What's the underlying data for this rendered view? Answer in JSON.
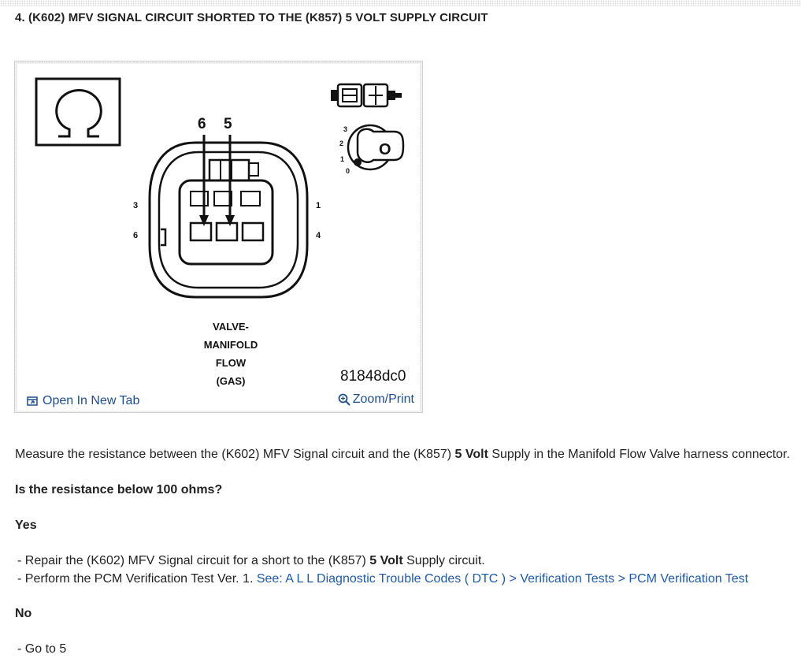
{
  "step": {
    "title": "4. (K602) MFV SIGNAL CIRCUIT SHORTED TO THE (K857) 5 VOLT SUPPLY CIRCUIT"
  },
  "figure": {
    "pin_labels": {
      "top_left": "6",
      "top_right": "5",
      "left_upper": "3",
      "left_lower": "6",
      "right_upper": "1",
      "right_lower": "4"
    },
    "key_positions": [
      "3",
      "2",
      "1",
      "0"
    ],
    "key_letter": "O",
    "component_label_lines": [
      "VALVE-",
      "MANIFOLD",
      "FLOW",
      "(GAS)"
    ],
    "code": "81848dc0",
    "open_new_tab_label": "Open In New Tab",
    "zoom_print_label": "Zoom/Print",
    "icons": {
      "omega": "ohmmeter-icon",
      "connector": "connector-icon",
      "key": "ignition-key-icon",
      "open": "open-tab-icon",
      "zoom": "magnifier-icon"
    }
  },
  "measure": {
    "pre": "Measure the resistance between the (K602) MFV Signal circuit and the (K857) ",
    "bold": "5 Volt",
    "post": " Supply in the Manifold Flow Valve harness connector."
  },
  "question": "Is the resistance below 100 ohms?",
  "yes": {
    "heading": "Yes",
    "item1_pre": "- Repair the (K602) MFV Signal circuit for a short to the (K857) ",
    "item1_bold": "5 Volt",
    "item1_post": " Supply circuit.",
    "item2_pre": "- Perform the PCM Verification Test Ver. 1. ",
    "item2_link": "See: A L L Diagnostic Trouble Codes ( DTC ) > Verification Tests > PCM Verification Test"
  },
  "no": {
    "heading": "No",
    "item1": "- Go to 5"
  }
}
